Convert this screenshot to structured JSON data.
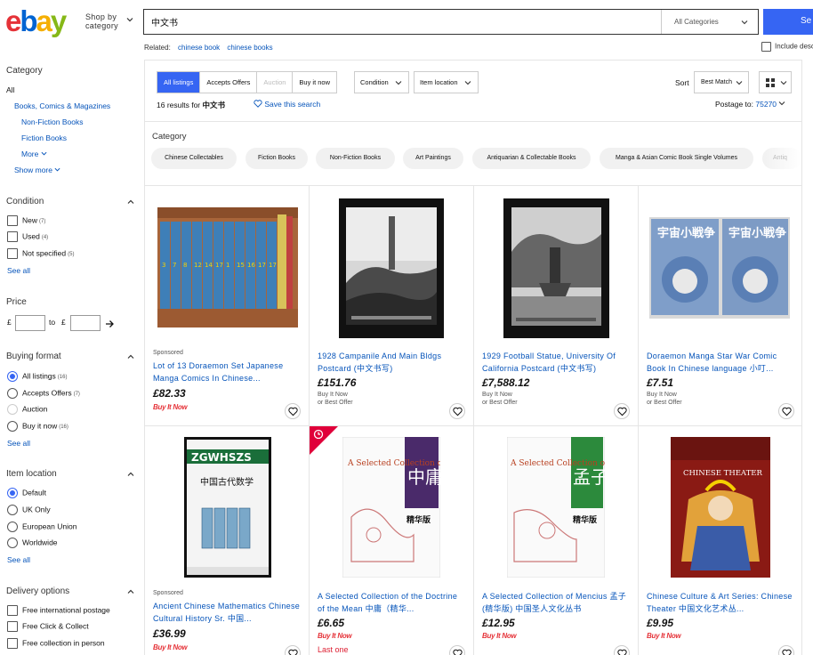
{
  "header": {
    "logo": {
      "e": "e",
      "b": "b",
      "a": "a",
      "y": "y"
    },
    "shop_by_line1": "Shop by",
    "shop_by_line2": "category",
    "search_value": "中文书",
    "category_select": "All Categories",
    "search_button": "Se"
  },
  "related": {
    "label": "Related:",
    "links": [
      "chinese book",
      "chinese books"
    ]
  },
  "include_description": "Include desc",
  "sidebar": {
    "category": {
      "heading": "Category",
      "all": "All",
      "items": [
        "Books, Comics & Magazines",
        "Non-Fiction Books",
        "Fiction Books",
        "More"
      ],
      "show_more": "Show more"
    },
    "condition": {
      "heading": "Condition",
      "options": [
        {
          "label": "New",
          "count": "(7)"
        },
        {
          "label": "Used",
          "count": "(4)"
        },
        {
          "label": "Not specified",
          "count": "(5)"
        }
      ],
      "see_all": "See all"
    },
    "price": {
      "heading": "Price",
      "currency": "£",
      "to": "to",
      "currency2": "£"
    },
    "buying_format": {
      "heading": "Buying format",
      "options": [
        {
          "label": "All listings",
          "count": "(16)"
        },
        {
          "label": "Accepts Offers",
          "count": "(7)"
        },
        {
          "label": "Auction",
          "count": ""
        },
        {
          "label": "Buy it now",
          "count": "(16)"
        }
      ],
      "see_all": "See all"
    },
    "item_location": {
      "heading": "Item location",
      "options": [
        "Default",
        "UK Only",
        "European Union",
        "Worldwide"
      ],
      "see_all": "See all"
    },
    "delivery": {
      "heading": "Delivery options",
      "options": [
        "Free international postage",
        "Free Click & Collect",
        "Free collection in person"
      ]
    }
  },
  "toolbar": {
    "tabs": [
      "All listings",
      "Accepts Offers",
      "Auction",
      "Buy it now"
    ],
    "condition": "Condition",
    "item_location": "Item location",
    "results_prefix": "16 results for",
    "results_query": "中文书",
    "save_search": "Save this search",
    "sort_label": "Sort",
    "sort_value": "Best Match",
    "postage_label": "Postage to:",
    "postage_zip": "75270"
  },
  "category_chips": {
    "label": "Category",
    "chips": [
      "Chinese Collectables",
      "Fiction Books",
      "Non-Fiction Books",
      "Art Paintings",
      "Antiquarian & Collectable Books",
      "Manga & Asian Comic Book Single Volumes",
      "Antiq"
    ]
  },
  "products": [
    {
      "sponsored": "Sponsored",
      "title": "Lot of 13 Doraemon Set Japanese Manga Comics In Chinese...",
      "price": "£82.33",
      "bin_label": "",
      "bin_sub": "",
      "bin_logo": "Buy It Now",
      "last_one": ""
    },
    {
      "sponsored": "",
      "title": "1928 Campanile And Main Bldgs Postcard (中文书写)",
      "price": "£151.76",
      "bin_label": "Buy It Now",
      "bin_sub": "or Best Offer",
      "bin_logo": "",
      "last_one": ""
    },
    {
      "sponsored": "",
      "title": "1929 Football Statue, University Of California Postcard (中文书写)",
      "price": "£7,588.12",
      "bin_label": "Buy It Now",
      "bin_sub": "or Best Offer",
      "bin_logo": "",
      "last_one": ""
    },
    {
      "sponsored": "",
      "title": "Doraemon Manga Star War Comic Book In Chinese language 小叮...",
      "price": "£7.51",
      "bin_label": "Buy It Now",
      "bin_sub": "or Best Offer",
      "bin_logo": "",
      "last_one": ""
    },
    {
      "sponsored": "Sponsored",
      "title": "Ancient Chinese Mathematics Chinese Cultural History Sr. 中国...",
      "price": "£36.99",
      "bin_label": "",
      "bin_sub": "",
      "bin_logo": "Buy It Now",
      "last_one": ""
    },
    {
      "sponsored": "",
      "title": "A Selected Collection of the Doctrine of the Mean 中庸（精华...",
      "price": "£6.65",
      "bin_label": "",
      "bin_sub": "",
      "bin_logo": "Buy It Now",
      "last_one": "Last one"
    },
    {
      "sponsored": "",
      "title": "A Selected Collection of Mencius 孟子 (精华版) 中国圣人文化丛书",
      "price": "£12.95",
      "bin_label": "",
      "bin_sub": "",
      "bin_logo": "Buy It Now",
      "last_one": ""
    },
    {
      "sponsored": "",
      "title": "Chinese Culture & Art Series: Chinese Theater 中国文化艺术丛...",
      "price": "£9.95",
      "bin_label": "",
      "bin_sub": "",
      "bin_logo": "Buy It Now",
      "last_one": ""
    }
  ],
  "thumb_text": {
    "zg": "ZGWHSZS",
    "math": "中国古代数学",
    "doctrine_en": "A Selected Collection of the Doctrine of the Mean",
    "doctrine_cn": "中庸",
    "mencius_en": "A Selected Collection of Mencius",
    "mencius_cn": "孟子",
    "edition": "精华版",
    "theater": "CHINESE THEATER",
    "manga_cn": "宇宙小戦争"
  },
  "colors": {
    "accent": "#3665f3",
    "link": "#0654ba",
    "price_red": "#dd1e31",
    "ribbon": "#e0003a"
  }
}
